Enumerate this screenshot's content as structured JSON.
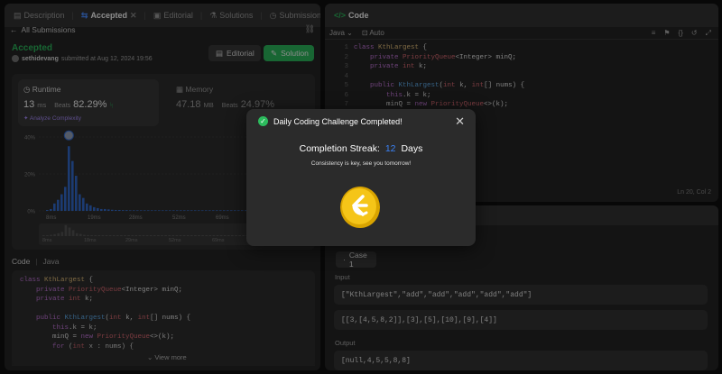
{
  "left_tabs": [
    {
      "label": "Description",
      "active": false
    },
    {
      "label": "Accepted",
      "active": true
    },
    {
      "label": "Editorial",
      "active": false
    },
    {
      "label": "Solutions",
      "active": false
    },
    {
      "label": "Submissions",
      "active": false
    }
  ],
  "submission": {
    "back_label": "All Submissions",
    "status": "Accepted",
    "user": "sethidevang",
    "submitted_text": "submitted at Aug 12, 2024 19:56",
    "editorial_btn": "Editorial",
    "solution_btn": "Solution"
  },
  "runtime": {
    "label": "Runtime",
    "value": "13",
    "unit": "ms",
    "beats_label": "Beats",
    "beats_value": "82.29%",
    "analyze": "Analyze Complexity"
  },
  "memory": {
    "label": "Memory",
    "value": "47.18",
    "unit": "MB",
    "beats_label": "Beats",
    "beats_value": "24.97%"
  },
  "chart_data": {
    "type": "bar",
    "y_ticks": [
      "40%",
      "20%",
      "0%"
    ],
    "x_ticks": [
      "8ms",
      "19ms",
      "28ms",
      "52ms",
      "69ms"
    ],
    "mini_x_ticks": [
      "8ms",
      "18ms",
      "29ms",
      "52ms",
      "69ms"
    ],
    "values": [
      0.5,
      1,
      4,
      6,
      9,
      13,
      35,
      27,
      19,
      9,
      7,
      4,
      3,
      2,
      1.5,
      1,
      1,
      0.8,
      0.6,
      0.5,
      0.5,
      0.4,
      0.4,
      0.3,
      0.3,
      0.3,
      0.3,
      0.3,
      0.3,
      0.3,
      0.3,
      0.3,
      0.3,
      0.3,
      0.3,
      0.3,
      0.3,
      0.3,
      0.3,
      0.3,
      0.3,
      0.3,
      0.3,
      0.3,
      0.3,
      0.3,
      0.3,
      0.3,
      0.3,
      0.3,
      0.3,
      0.3,
      0.3,
      0.3,
      0.3,
      0.3,
      0.3,
      0.3,
      0.3,
      0.3
    ],
    "ylim": [
      0,
      40
    ],
    "highlight_index": 6
  },
  "left_code": {
    "header": "Code",
    "lang": "Java",
    "view_more": "View more",
    "lines": [
      [
        {
          "t": "class ",
          "c": "kw"
        },
        {
          "t": "KthLargest",
          "c": "var"
        },
        {
          "t": " {",
          "c": "pl"
        }
      ],
      [
        {
          "t": "    private ",
          "c": "kw"
        },
        {
          "t": "PriorityQueue",
          "c": "ty"
        },
        {
          "t": "<Integer> minQ;",
          "c": "pl"
        }
      ],
      [
        {
          "t": "    private ",
          "c": "kw"
        },
        {
          "t": "int",
          "c": "ty"
        },
        {
          "t": " k;",
          "c": "pl"
        }
      ],
      [
        {
          "t": "",
          "c": "pl"
        }
      ],
      [
        {
          "t": "    public ",
          "c": "kw"
        },
        {
          "t": "KthLargest",
          "c": "fn"
        },
        {
          "t": "(",
          "c": "pl"
        },
        {
          "t": "int",
          "c": "ty"
        },
        {
          "t": " k, ",
          "c": "pl"
        },
        {
          "t": "int",
          "c": "ty"
        },
        {
          "t": "[] nums) {",
          "c": "pl"
        }
      ],
      [
        {
          "t": "        this",
          "c": "kw"
        },
        {
          "t": ".k = k;",
          "c": "pl"
        }
      ],
      [
        {
          "t": "        minQ = ",
          "c": "pl"
        },
        {
          "t": "new ",
          "c": "kw"
        },
        {
          "t": "PriorityQueue",
          "c": "ty"
        },
        {
          "t": "<>(k);",
          "c": "pl"
        }
      ],
      [
        {
          "t": "        for ",
          "c": "kw"
        },
        {
          "t": "(",
          "c": "pl"
        },
        {
          "t": "int",
          "c": "ty"
        },
        {
          "t": " x : nums) {",
          "c": "pl"
        }
      ]
    ]
  },
  "right_code": {
    "header": "Code",
    "lang": "Java",
    "auto": "Auto",
    "status": "Ln 20, Col 2",
    "line_numbers": [
      "1",
      "2",
      "3",
      "4",
      "5",
      "6",
      "7",
      "8"
    ],
    "lines": [
      [
        {
          "t": "class ",
          "c": "kw"
        },
        {
          "t": "KthLargest",
          "c": "var"
        },
        {
          "t": " {",
          "c": "pl"
        }
      ],
      [
        {
          "t": "    private ",
          "c": "kw"
        },
        {
          "t": "PriorityQueue",
          "c": "ty"
        },
        {
          "t": "<Integer> minQ;",
          "c": "pl"
        }
      ],
      [
        {
          "t": "    private ",
          "c": "kw"
        },
        {
          "t": "int",
          "c": "ty"
        },
        {
          "t": " k;",
          "c": "pl"
        }
      ],
      [
        {
          "t": "",
          "c": "pl"
        }
      ],
      [
        {
          "t": "    public ",
          "c": "kw"
        },
        {
          "t": "KthLargest",
          "c": "fn"
        },
        {
          "t": "(",
          "c": "pl"
        },
        {
          "t": "int",
          "c": "ty"
        },
        {
          "t": " k, ",
          "c": "pl"
        },
        {
          "t": "int",
          "c": "ty"
        },
        {
          "t": "[] nums) {",
          "c": "pl"
        }
      ],
      [
        {
          "t": "        this",
          "c": "kw"
        },
        {
          "t": ".k = k;",
          "c": "pl"
        }
      ],
      [
        {
          "t": "        minQ = ",
          "c": "pl"
        },
        {
          "t": "new ",
          "c": "kw"
        },
        {
          "t": "PriorityQueue",
          "c": "ty"
        },
        {
          "t": "<>(k);",
          "c": "pl"
        }
      ],
      [
        {
          "t": "",
          "c": "pl"
        }
      ]
    ]
  },
  "testcase": {
    "case_label": "Case 1",
    "input_label": "Input",
    "input_line1": "[\"KthLargest\",\"add\",\"add\",\"add\",\"add\",\"add\"]",
    "input_line2": "[[3,[4,5,8,2]],[3],[5],[10],[9],[4]]",
    "output_label": "Output",
    "output_value": "[null,4,5,5,8,8]"
  },
  "modal": {
    "title": "Daily Coding Challenge Completed!",
    "streak_prefix": "Completion Streak:",
    "streak_value": "12",
    "streak_suffix": "Days",
    "subtitle": "Consistency is key, see you tomorrow!"
  },
  "colors": {
    "accent_green": "#2cbb5d",
    "bar_blue": "#3470d9",
    "streak_blue": "#3b82f6",
    "coin_gold": "#f5c518"
  }
}
